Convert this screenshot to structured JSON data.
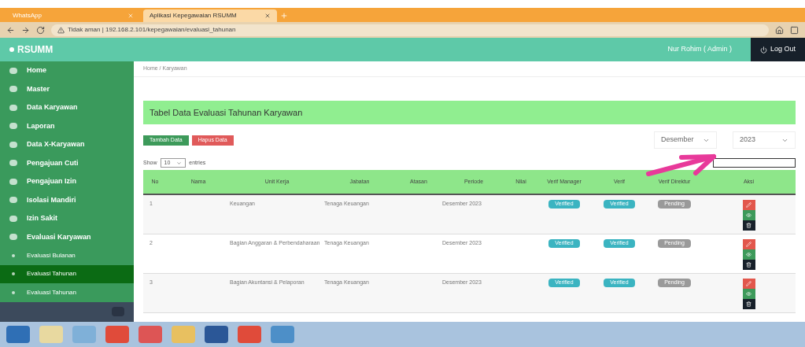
{
  "browser": {
    "tabs": [
      {
        "title": "WhatsApp",
        "selected": false
      },
      {
        "title": "Aplikasi Kepegawaian RSUMM",
        "selected": true
      }
    ],
    "address": "Tidak aman | 192.168.2.101/kepegawaian/evaluasi_tahunan"
  },
  "app": {
    "brand": "RSUMM",
    "user": "Nur Rohim ( Admin )",
    "logout": "Log Out"
  },
  "sidebar": {
    "items": [
      {
        "label": "Home",
        "selected": false,
        "sub": false
      },
      {
        "label": "Master",
        "selected": false,
        "sub": false
      },
      {
        "label": "Data Karyawan",
        "selected": false,
        "sub": false
      },
      {
        "label": "Laporan",
        "selected": false,
        "sub": false
      },
      {
        "label": "Data X-Karyawan",
        "selected": false,
        "sub": false
      },
      {
        "label": "Pengajuan Cuti",
        "selected": false,
        "sub": false
      },
      {
        "label": "Pengajuan Izin",
        "selected": false,
        "sub": false
      },
      {
        "label": "Isolasi Mandiri",
        "selected": false,
        "sub": false
      },
      {
        "label": "Izin Sakit",
        "selected": false,
        "sub": false
      },
      {
        "label": "Evaluasi Karyawan",
        "selected": false,
        "sub": false
      },
      {
        "label": "Evaluasi Bulanan",
        "selected": false,
        "sub": true
      },
      {
        "label": "Evaluasi Tahunan",
        "selected": true,
        "sub": true
      },
      {
        "label": "Evaluasi Tahunan",
        "selected": false,
        "sub": true
      }
    ]
  },
  "breadcrumb": "Home / Karyawan",
  "panel_title": "Tabel Data Evaluasi Tahunan Karyawan",
  "buttons": [
    {
      "label": "Tambah Data",
      "kind": "add"
    },
    {
      "label": "Hapus Data",
      "kind": "delete"
    }
  ],
  "filters": [
    {
      "value": "Desember"
    },
    {
      "value": "2023"
    }
  ],
  "length": {
    "before": "Show",
    "value": "10",
    "after": "entries"
  },
  "table": {
    "columns": [
      "No",
      "Nama",
      "Unit Kerja",
      "Jabatan",
      "Atasan",
      "Periode",
      "Nilai",
      "Verif Manager",
      "Verif",
      "Verif Direktur",
      "Aksi"
    ],
    "rows": [
      {
        "no": "1",
        "unit": "Keuangan",
        "jabatan": "Tenaga Keuangan",
        "periode": "Desember 2023",
        "statuses": [
          {
            "label": "Verified",
            "kind": "verified"
          },
          {
            "label": "Verified",
            "kind": "verified"
          },
          {
            "label": "Pending",
            "kind": "pending"
          }
        ]
      },
      {
        "no": "2",
        "unit": "Bagian Anggaran & Perbendaharaan",
        "jabatan": "Tenaga Keuangan",
        "periode": "Desember 2023",
        "statuses": [
          {
            "label": "Verified",
            "kind": "verified"
          },
          {
            "label": "Verified",
            "kind": "verified"
          },
          {
            "label": "Pending",
            "kind": "pending"
          }
        ]
      },
      {
        "no": "3",
        "unit": "Bagian Akuntansi & Pelaporan",
        "jabatan": "Tenaga Keuangan",
        "periode": "Desember 2023",
        "statuses": [
          {
            "label": "Verified",
            "kind": "verified"
          },
          {
            "label": "Verified",
            "kind": "verified"
          },
          {
            "label": "Pending",
            "kind": "pending"
          }
        ]
      }
    ]
  }
}
